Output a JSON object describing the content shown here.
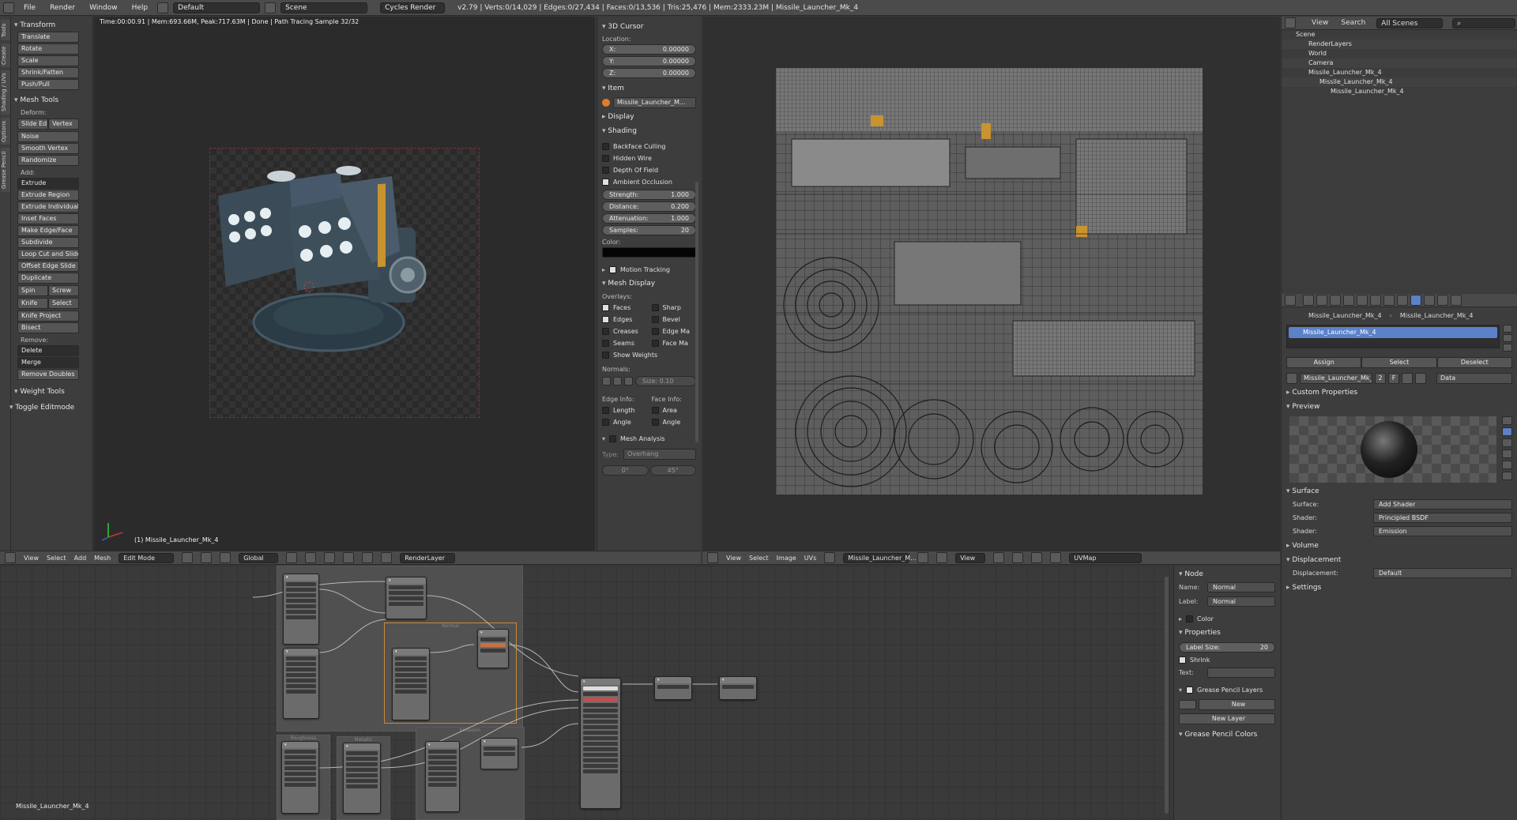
{
  "topbar": {
    "menus": [
      "File",
      "Render",
      "Window",
      "Help"
    ],
    "screen_layout": "Default",
    "scene": "Scene",
    "engine": "Cycles Render",
    "stats": "v2.79 | Verts:0/14,029 | Edges:0/27,434 | Faces:0/13,536 | Tris:25,476 | Mem:2333.23M | Missile_Launcher_Mk_4"
  },
  "vtabs": [
    "Tools",
    "Create",
    "Shading / UVs",
    "Options",
    "Grease Pencil"
  ],
  "toolshelf": {
    "transform_title": "Transform",
    "transform": [
      "Translate",
      "Rotate",
      "Scale",
      "Shrink/Fatten",
      "Push/Pull"
    ],
    "mesh_tools_title": "Mesh Tools",
    "deform_label": "Deform:",
    "deform_pair": [
      "Slide Ed",
      "Vertex"
    ],
    "deform": [
      "Noise",
      "Smooth Vertex",
      "Randomize"
    ],
    "add_label": "Add:",
    "extrude": "Extrude",
    "add": [
      "Extrude Region",
      "Extrude Individual",
      "Inset Faces",
      "Make Edge/Face",
      "Subdivide",
      "Loop Cut and Slide",
      "Offset Edge Slide",
      "Duplicate"
    ],
    "spin_pair": [
      "Spin",
      "Screw"
    ],
    "knife_pair": [
      "Knife",
      "Select"
    ],
    "add2": [
      "Knife Project",
      "Bisect"
    ],
    "remove_label": "Remove:",
    "delete": "Delete",
    "merge": "Merge",
    "remove_doubles": "Remove Doubles",
    "weight_tools": "Weight Tools",
    "toggle_editmode": "Toggle Editmode"
  },
  "viewport": {
    "info": "Time:00:00.91 | Mem:693.66M, Peak:717.63M | Done | Path Tracing Sample 32/32",
    "object_label": "(1) Missile_Launcher_Mk_4"
  },
  "npanel": {
    "cursor_title": "3D Cursor",
    "location_label": "Location:",
    "x": "0.00000",
    "y": "0.00000",
    "z": "0.00000",
    "x_label": "X:",
    "y_label": "Y:",
    "z_label": "Z:",
    "item_title": "Item",
    "item_name": "Missile_Launcher_M...",
    "display_title": "Display",
    "shading_title": "Shading",
    "shading_checks": [
      "Backface Culling",
      "Hidden Wire",
      "Depth Of Field",
      "Ambient Occlusion"
    ],
    "strength_label": "Strength:",
    "strength": "1.000",
    "distance_label": "Distance:",
    "distance": "0.200",
    "attenuation_label": "Attenuation:",
    "attenuation": "1.000",
    "samples_label": "Samples:",
    "samples": "20",
    "color_label": "Color:",
    "motion_tracking": "Motion Tracking",
    "mesh_display": "Mesh Display",
    "overlays_label": "Overlays:",
    "overlays_left": [
      "Faces",
      "Edges",
      "Creases",
      "Seams"
    ],
    "overlays_right": [
      "Sharp",
      "Bevel",
      "Edge Ma",
      "Face Ma"
    ],
    "show_weights": "Show Weights",
    "normals_label": "Normals:",
    "normals_size": "Size: 0.10",
    "edge_info": "Edge Info:",
    "face_info": "Face Info:",
    "edge_checks": [
      "Length",
      "Angle"
    ],
    "face_checks": [
      "Area",
      "Angle"
    ],
    "mesh_analysis": "Mesh Analysis",
    "type_label": "Type:",
    "type_value": "Overhang",
    "angle_min": "0°",
    "angle_max": "45°"
  },
  "view3d_header": {
    "menus": [
      "View",
      "Select",
      "Add",
      "Mesh"
    ],
    "mode": "Edit Mode",
    "orientation": "Global",
    "layer": "RenderLayer"
  },
  "uv_header": {
    "menus": [
      "View",
      "Select",
      "Image",
      "UVs"
    ],
    "image": "Missile_Launcher_M...",
    "view": "View",
    "uvmap": "UVMap"
  },
  "outliner": {
    "view": "View",
    "search": "Search",
    "scenes": "All Scenes",
    "rows": [
      "Scene",
      "RenderLayers",
      "World",
      "Camera",
      "Missile_Launcher_Mk_4",
      "Missile_Launcher_Mk_4",
      "Missile_Launcher_Mk_4"
    ]
  },
  "props": {
    "breadcrumb1": "Missile_Launcher_Mk_4",
    "breadcrumb2": "Missile_Launcher_Mk_4",
    "slot": "Missile_Launcher_Mk_4",
    "assign": "Assign",
    "select": "Select",
    "deselect": "Deselect",
    "material_name": "Missile_Launcher_Mk_4",
    "users": "2",
    "fake": "F",
    "data": "Data",
    "custom_properties": "Custom Properties",
    "preview": "Preview",
    "surface": "Surface",
    "surface_label": "Surface:",
    "surface_value": "Add Shader",
    "shader_label": "Shader:",
    "shader1": "Principled BSDF",
    "shader2": "Emission",
    "volume": "Volume",
    "displacement": "Displacement",
    "displacement_label": "Displacement:",
    "displacement_value": "Default",
    "settings": "Settings"
  },
  "nodepanel": {
    "node_title": "Node",
    "name_label": "Name:",
    "name_value": "Normal",
    "label_label": "Label:",
    "label_value": "Normal",
    "color": "Color",
    "properties": "Properties",
    "label_size_label": "Label Size:",
    "label_size": "20",
    "shrink": "Shrink",
    "text_label": "Text:",
    "gp_layers": "Grease Pencil Layers",
    "new": "New",
    "new_layer": "New Layer",
    "gp_colors": "Grease Pencil Colors"
  },
  "node_editor": {
    "object_label": "Missile_Launcher_Mk_4",
    "frames": [
      "Normal",
      "Roughness",
      "Metallic",
      "Emission"
    ]
  },
  "colors": {
    "selection_blue": "#5b82c8",
    "accent_orange": "#e07b2a",
    "active_frame": "#c88a3a"
  }
}
